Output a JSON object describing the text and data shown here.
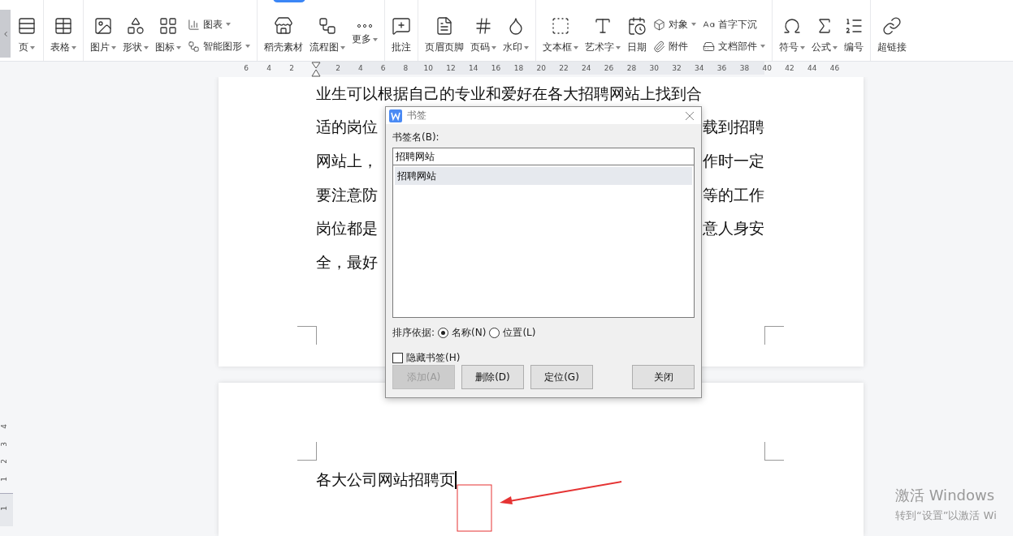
{
  "toolbar": {
    "groups": [
      {
        "items": [
          {
            "kind": "big",
            "label": "页",
            "dropdown": true
          }
        ]
      },
      {
        "items": [
          {
            "kind": "big",
            "label": "表格",
            "dropdown": true
          }
        ]
      },
      {
        "items": [
          {
            "kind": "big",
            "label": "图片",
            "dropdown": true
          },
          {
            "kind": "big",
            "label": "形状",
            "dropdown": true
          },
          {
            "kind": "big",
            "label": "图标",
            "dropdown": true
          },
          {
            "kind": "stack",
            "items": [
              {
                "label": "图表",
                "dropdown": true
              },
              {
                "label": "智能图形",
                "dropdown": true
              }
            ]
          }
        ]
      },
      {
        "items": [
          {
            "kind": "big",
            "label": "稻壳素材",
            "dropdown": false
          },
          {
            "kind": "big",
            "label": "流程图",
            "dropdown": true
          },
          {
            "kind": "big",
            "label": "更多",
            "dropdown": true
          }
        ]
      },
      {
        "items": [
          {
            "kind": "big",
            "label": "批注",
            "dropdown": false
          }
        ]
      },
      {
        "items": [
          {
            "kind": "big",
            "label": "页眉页脚",
            "dropdown": false
          },
          {
            "kind": "big",
            "label": "页码",
            "dropdown": true
          },
          {
            "kind": "big",
            "label": "水印",
            "dropdown": true
          }
        ]
      },
      {
        "items": [
          {
            "kind": "big",
            "label": "文本框",
            "dropdown": true
          },
          {
            "kind": "big",
            "label": "艺术字",
            "dropdown": true
          },
          {
            "kind": "big",
            "label": "日期",
            "dropdown": false
          },
          {
            "kind": "stack",
            "items": [
              {
                "label": "对象",
                "dropdown": true
              },
              {
                "label": "附件",
                "dropdown": false
              }
            ]
          },
          {
            "kind": "stack",
            "items": [
              {
                "label": "首字下沉",
                "dropdown": false
              },
              {
                "label": "文档部件",
                "dropdown": true
              }
            ]
          }
        ]
      },
      {
        "items": [
          {
            "kind": "big",
            "label": "符号",
            "dropdown": true
          },
          {
            "kind": "big",
            "label": "公式",
            "dropdown": true
          },
          {
            "kind": "big",
            "label": "编号",
            "dropdown": false
          }
        ]
      },
      {
        "items": [
          {
            "kind": "big",
            "label": "超链接",
            "dropdown": false
          }
        ]
      }
    ]
  },
  "ruler": {
    "left_ticks": [
      "6",
      "4",
      "2"
    ],
    "right_ticks": [
      "2",
      "4",
      "6",
      "8",
      "10",
      "12",
      "14",
      "16",
      "18",
      "20",
      "22",
      "24",
      "26",
      "28",
      "30",
      "32",
      "34",
      "36",
      "38",
      "40",
      "42",
      "44",
      "46"
    ]
  },
  "vertical_ruler": {
    "ticks": [
      "4",
      "3",
      "2",
      "1"
    ],
    "current": "1"
  },
  "page_1": {
    "lines": [
      {
        "left": "业生可以根据自己的专业和爱好在各大招聘网站上找到合"
      },
      {
        "left": "适的岗位",
        "right": "载到招聘"
      },
      {
        "left": "网站上，",
        "right": "作时一定"
      },
      {
        "left": "要注意防",
        "right": "等的工作"
      },
      {
        "left": "岗位都是",
        "right": "意人身安"
      },
      {
        "left": "全，最好"
      }
    ]
  },
  "page_2": {
    "lines": [
      "各大公司网站招聘页"
    ]
  },
  "dialog": {
    "title": "书签",
    "name_label": "书签名(B):",
    "name_value": "招聘网站",
    "bookmarks": [
      {
        "label": "招聘网站",
        "selected": true
      }
    ],
    "sort_label": "排序依据:",
    "sort_options": [
      {
        "label": "名称(N)",
        "selected": true
      },
      {
        "label": "位置(L)",
        "selected": false
      }
    ],
    "hide": {
      "label": "隐藏书签(H)",
      "checked": false
    },
    "buttons": [
      {
        "label": "添加(A)",
        "disabled": true
      },
      {
        "label": "删除(D)",
        "disabled": false
      },
      {
        "label": "定位(G)",
        "disabled": false
      },
      {
        "label": "关闭",
        "disabled": false
      }
    ]
  },
  "activation": {
    "title": "激活 Windows",
    "subtitle": "转到“设置”以激活 Wi"
  }
}
